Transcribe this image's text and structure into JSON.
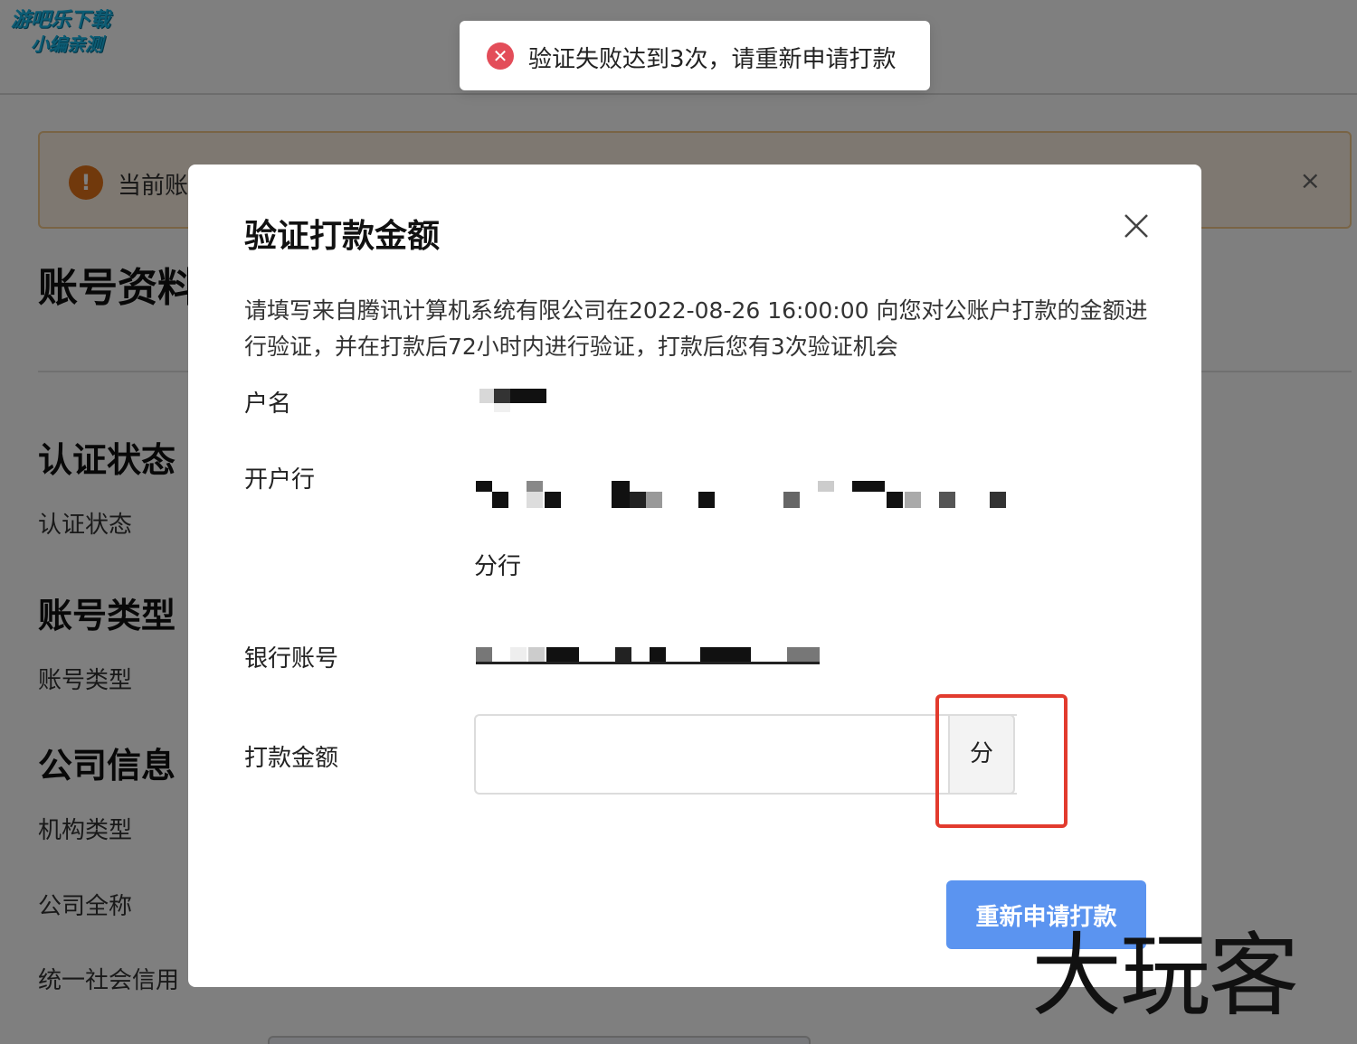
{
  "watermark": {
    "logo_line1": "游吧乐下载",
    "logo_line2": "小编亲测",
    "corner_text": "大玩客"
  },
  "alert": {
    "icon": "exclamation-icon",
    "text": "当前账",
    "close": "×"
  },
  "page": {
    "title": "账号资料",
    "sections": [
      {
        "heading": "认证状态",
        "label": "认证状态"
      },
      {
        "heading": "账号类型",
        "label": "账号类型"
      },
      {
        "heading": "公司信息",
        "labels": [
          "机构类型",
          "公司全称",
          "统一社会信用"
        ]
      }
    ]
  },
  "toast": {
    "icon": "error-circle-icon",
    "message": "验证失败达到3次，请重新申请打款",
    "color": "#e34d59"
  },
  "modal": {
    "title": "验证打款金额",
    "close_icon": "close-icon",
    "description": "请填写来自腾讯计算机系统有限公司在2022-08-26 16:00:00 向您对公账户打款的金额进行验证，并在打款后72小时内进行验证，打款后您有3次验证机会",
    "fields": {
      "account_name_label": "户名",
      "bank_label": "开户行",
      "bank_suffix": "分行",
      "account_number_label": "银行账号",
      "amount_label": "打款金额"
    },
    "amount": {
      "value": "",
      "unit": "分"
    },
    "resubmit_button": "重新申请打款",
    "button_color": "#5b94f0"
  }
}
